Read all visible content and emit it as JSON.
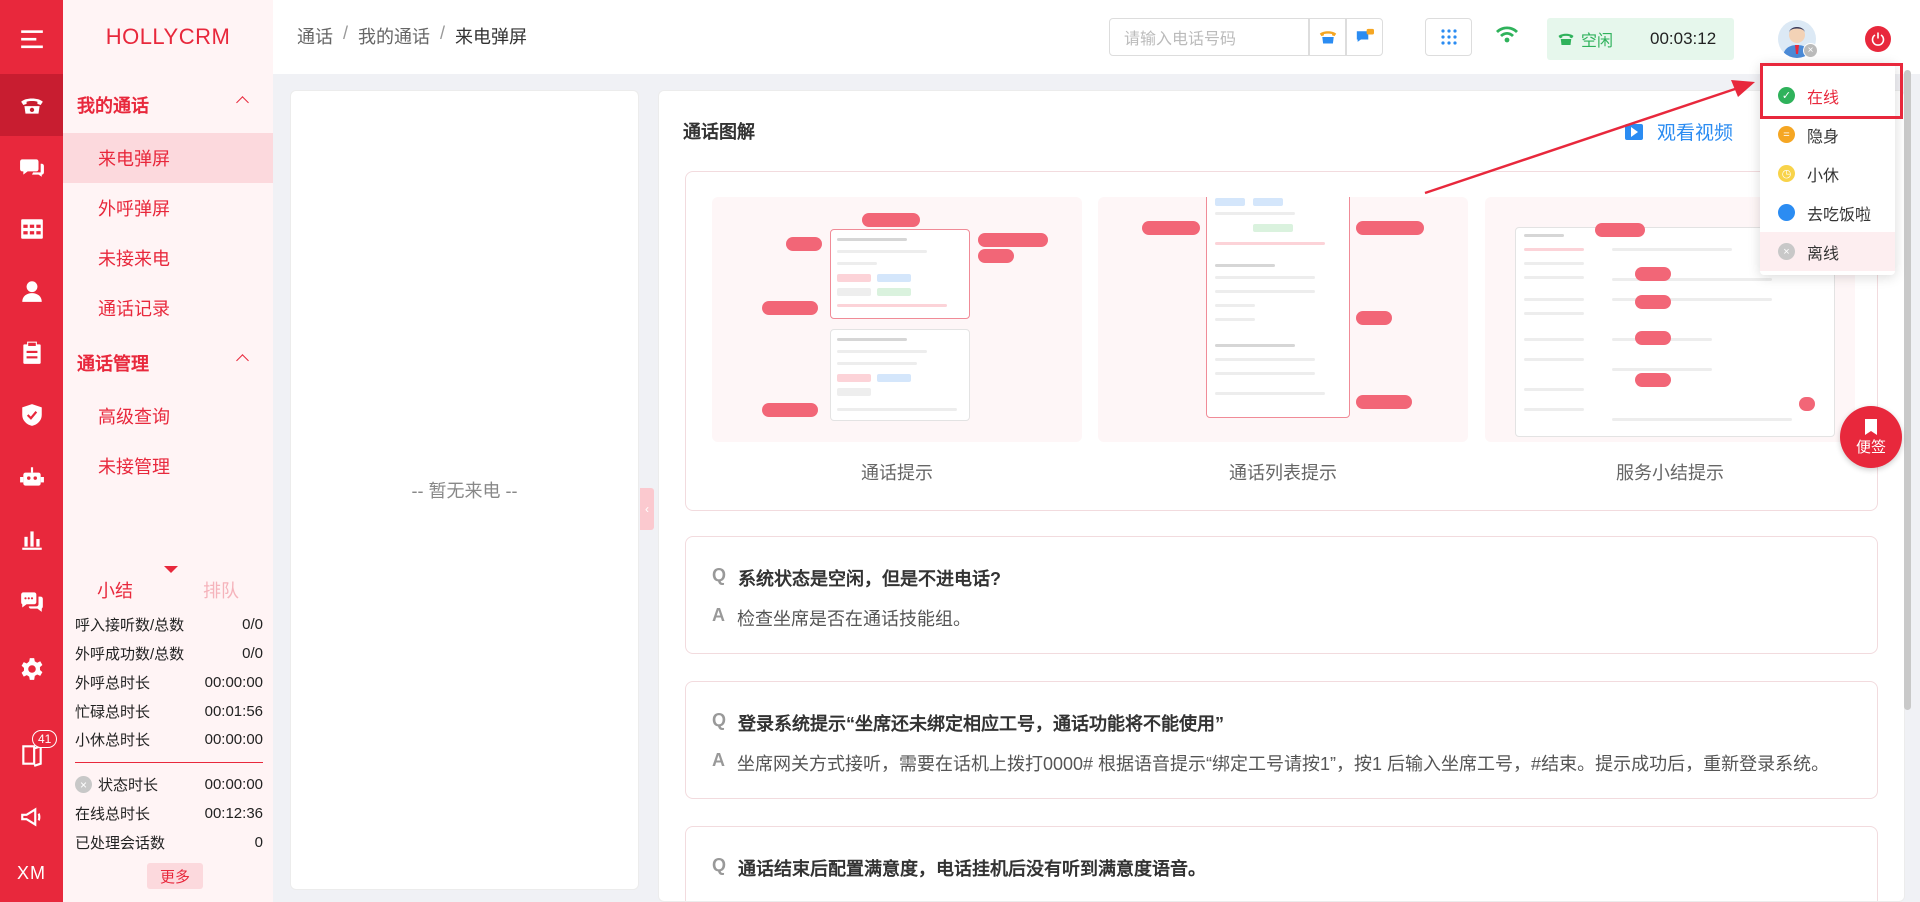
{
  "app": {
    "brand": "HOLLYCRM"
  },
  "rail": {
    "icons": [
      "menu-icon",
      "phone-icon",
      "chat-icon",
      "grid-icon",
      "user-icon",
      "clipboard-icon",
      "shield-icon",
      "robot-icon",
      "chart-icon",
      "message-icon",
      "gear-icon",
      "book-icon",
      "megaphone-icon"
    ],
    "badge": "41",
    "bottom_label": "XM"
  },
  "menu": {
    "group1": "我的通话",
    "items1": [
      "来电弹屏",
      "外呼弹屏",
      "未接来电",
      "通话记录"
    ],
    "group2": "通话管理",
    "items2": [
      "高级查询",
      "未接管理"
    ]
  },
  "summary": {
    "tab_active": "小结",
    "tab_inactive": "排队",
    "stats": [
      {
        "label": "呼入接听数/总数",
        "value": "0/0"
      },
      {
        "label": "外呼成功数/总数",
        "value": "0/0"
      },
      {
        "label": "外呼总时长",
        "value": "00:00:00"
      },
      {
        "label": "忙碌总时长",
        "value": "00:01:56"
      },
      {
        "label": "小休总时长",
        "value": "00:00:00"
      }
    ],
    "stats2": [
      {
        "label": "状态时长",
        "value": "00:00:00"
      },
      {
        "label": "在线总时长",
        "value": "00:12:36"
      },
      {
        "label": "已处理会话数",
        "value": "0"
      }
    ],
    "more": "更多"
  },
  "header": {
    "breadcrumb": [
      "通话",
      "我的通话",
      "来电弹屏"
    ],
    "phone_placeholder": "请输入电话号码",
    "status": "空闲",
    "timer": "00:03:12"
  },
  "incoming": {
    "empty_text": "-- 暂无来电 --"
  },
  "main": {
    "title": "通话图解",
    "video_link": "观看视频",
    "cards": [
      "通话提示",
      "通话列表提示",
      "服务小结提示"
    ],
    "faqs": [
      {
        "q": "系统状态是空闲，但是不进电话?",
        "a": "检查坐席是否在通话技能组。"
      },
      {
        "q": "登录系统提示“坐席还未绑定相应工号，通话功能将不能使用”",
        "a": "坐席网关方式接听，需要在话机上拨打0000# 根据语音提示“绑定工号请按1”，按1 后输入坐席工号，#结束。提示成功后，重新登录系统。"
      },
      {
        "q": "通话结束后配置满意度，电话挂机后没有听到满意度语音。",
        "a": ""
      }
    ],
    "q_mark": "Q",
    "a_mark": "A"
  },
  "note_button": "便签",
  "status_menu": [
    {
      "label": "在线",
      "color": "#2fb25b"
    },
    {
      "label": "隐身",
      "color": "#f5a623"
    },
    {
      "label": "小休",
      "color": "#f8d34a"
    },
    {
      "label": "去吃饭啦",
      "color": "#2b8cf2"
    },
    {
      "label": "离线",
      "color": "#c8c8c8"
    }
  ]
}
